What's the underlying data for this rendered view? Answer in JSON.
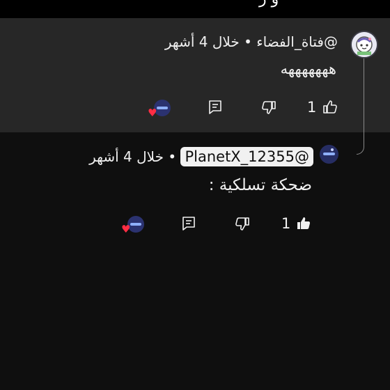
{
  "top": {
    "glyph": "و ر"
  },
  "comments": [
    {
      "handle": "@فتاة_الفضاء",
      "separator": "•",
      "time": "خلال 4 أشهر",
      "text": "هههههههه",
      "likes": "1"
    },
    {
      "handle": "@PlanetX_12355",
      "separator": "•",
      "time": "خلال 4 أشهر",
      "text": "ضحكة تسلكية :",
      "likes": "1"
    }
  ],
  "colors": {
    "background": "#0f0f0f",
    "highlight": "#272727",
    "heart": "#ff2d44"
  }
}
